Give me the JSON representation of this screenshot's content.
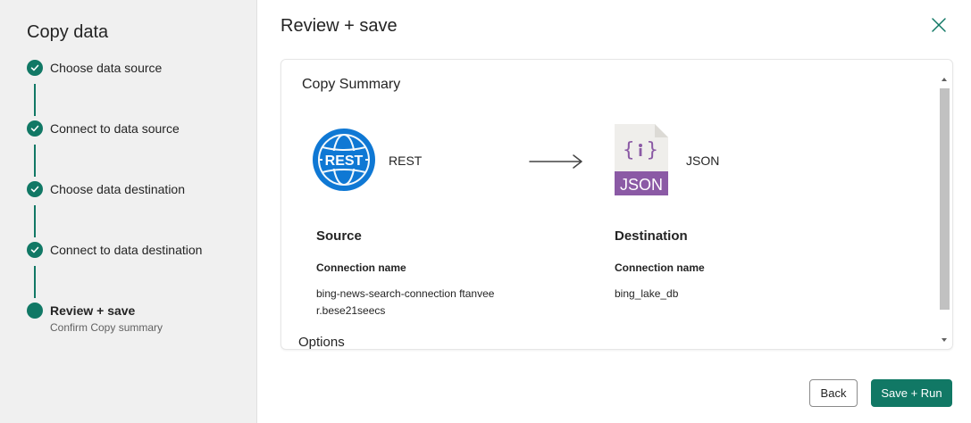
{
  "sidebar": {
    "title": "Copy data",
    "steps": [
      {
        "label": "Choose data source"
      },
      {
        "label": "Connect to data source"
      },
      {
        "label": "Choose data destination"
      },
      {
        "label": "Connect to data destination"
      },
      {
        "label": "Review + save",
        "sublabel": "Confirm Copy summary"
      }
    ]
  },
  "main": {
    "title": "Review + save",
    "summary": {
      "title": "Copy Summary",
      "source": {
        "type": "REST",
        "icon_text": "REST",
        "heading": "Source",
        "connection_label": "Connection name",
        "connection_value_line1": "bing-news-search-connection ftanvee",
        "connection_value_line2": "r.bese21seecs"
      },
      "destination": {
        "type": "JSON",
        "icon_text": "JSON",
        "heading": "Destination",
        "connection_label": "Connection name",
        "connection_value": "bing_lake_db"
      },
      "options_heading": "Options"
    }
  },
  "footer": {
    "back_label": "Back",
    "save_run_label": "Save + Run"
  },
  "colors": {
    "accent": "#117865",
    "rest_blue": "#0f78d4",
    "json_purple": "#8b5aa5",
    "sidebar_bg": "#f0f0f0"
  },
  "icons": [
    "check-icon",
    "close-icon",
    "globe-icon",
    "json-file-icon",
    "arrow-right-icon"
  ]
}
